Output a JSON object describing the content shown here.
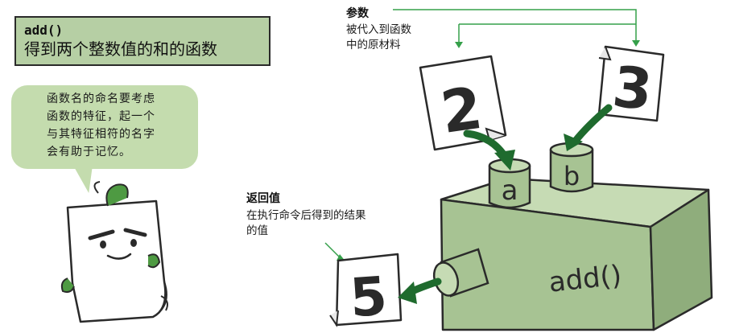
{
  "header": {
    "code": "add()",
    "description": "得到两个整数值的和的函数"
  },
  "bubble": {
    "lines": [
      "函数名的命名要考虑",
      "函数的特征，起一个",
      "与其特征相符的名字",
      "会有助于记忆。"
    ]
  },
  "params": {
    "title": "参数",
    "lines": [
      "被代入到函数",
      "中的原材料"
    ]
  },
  "return_value": {
    "title": "返回值",
    "lines": [
      "在执行命令后得到的结果",
      "的值"
    ]
  },
  "cards": {
    "input_a": "2",
    "input_b": "3",
    "output": "5"
  },
  "machine": {
    "label": "add()",
    "slot_a": "a",
    "slot_b": "b"
  },
  "colors": {
    "title_bg": "#b6cfa4",
    "bubble_bg": "#c4dcae",
    "machine_front": "#a7c393",
    "machine_top": "#c6dbb4",
    "machine_side": "#8fad7c",
    "arrow": "#1f6b2e",
    "bracket": "#35a04a"
  }
}
